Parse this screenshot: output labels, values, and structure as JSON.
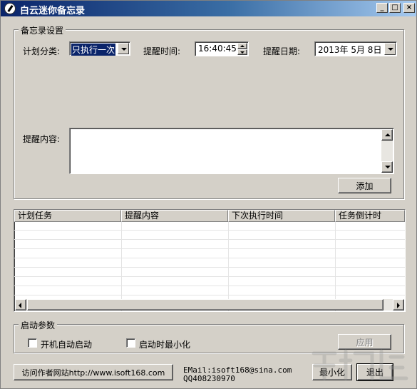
{
  "window": {
    "title": "白云迷你备忘录",
    "minimize_glyph": "_",
    "maximize_glyph": "□",
    "close_glyph": "×"
  },
  "settings": {
    "legend": "备忘录设置",
    "category_label": "计划分类:",
    "category_value": "只执行一次",
    "time_label": "提醒时间:",
    "time_value": "16:40:45",
    "date_label": "提醒日期:",
    "date_value": "2013年 5月 8日",
    "content_label": "提醒内容:",
    "content_value": "",
    "add_button": "添加"
  },
  "task_list": {
    "columns": [
      "计划任务",
      "提醒内容",
      "下次执行时间",
      "任务倒计时"
    ],
    "rows": []
  },
  "startup": {
    "legend": "启动参数",
    "autostart_label": "开机自动启动",
    "autostart_checked": false,
    "minimize_label": "启动时最小化",
    "minimize_checked": false,
    "apply_button": "应用"
  },
  "footer": {
    "visit_button": "访问作者网站http://www.isoft168.com",
    "email_text": "EMail:isoft168@sina.com",
    "qq_text": "QQ408230970",
    "minimize_button": "最小化",
    "exit_button": "退出"
  },
  "colors": {
    "titlebar_start": "#0a246a",
    "titlebar_end": "#a6caf0",
    "face": "#d4d0c8",
    "selection": "#0a246a"
  }
}
